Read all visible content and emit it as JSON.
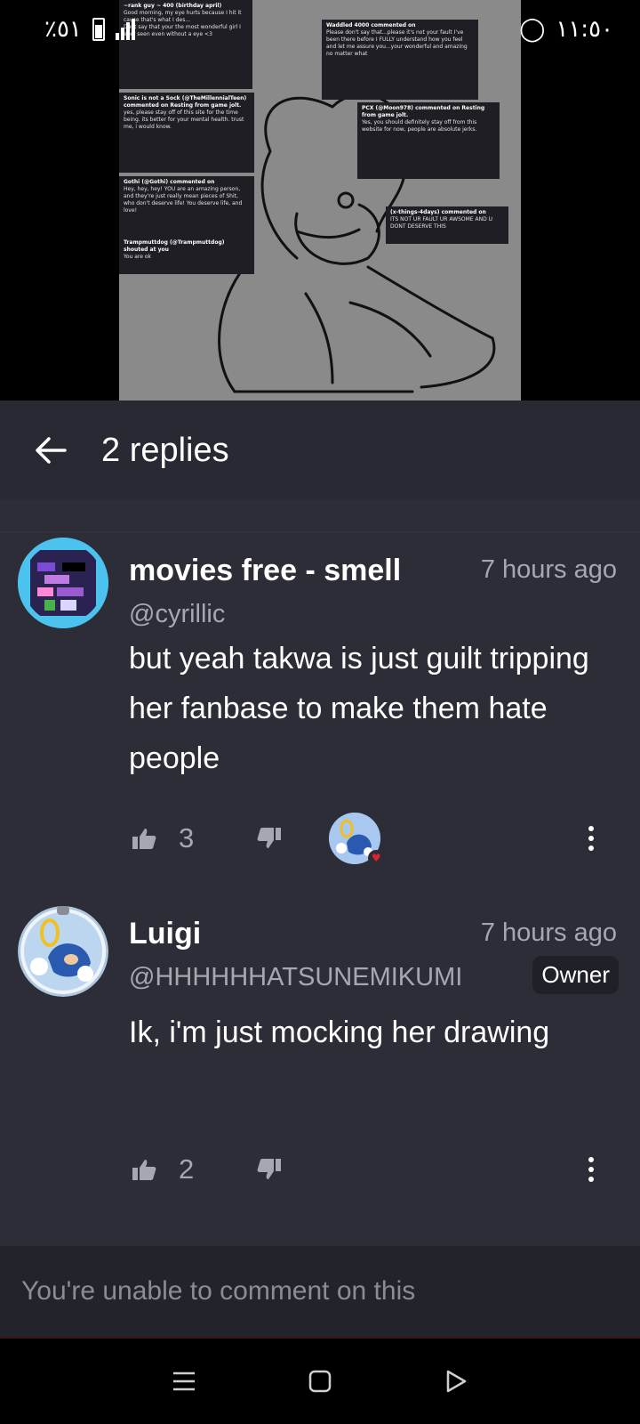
{
  "status_bar": {
    "battery_text": "٪٥١",
    "time": "١١:٥٠"
  },
  "media_notes": [
    {
      "user": "Sonic is not a Sock (@TheMillennialTeen) commented on Resting from game jolt.",
      "text": "yes, please stay off of this site for the time being. its better for your mental health. trust me, i would know."
    },
    {
      "user": "Trampmuttdog (@Trampmuttdog) shouted at you",
      "text": "You are ok"
    },
    {
      "user": "PCX (@Moon978) commented on Resting from game jolt.",
      "text": "Yes, you should definitely stay off from this website for now, people are absolute jerks."
    }
  ],
  "header": {
    "title": "2 replies"
  },
  "comments": [
    {
      "username": "movies free - smell",
      "timestamp": "7 hours ago",
      "handle": "@cyrillic",
      "body": "but yeah takwa is just guilt tripping her fanbase to make them hate people",
      "likes": "3",
      "badge": ""
    },
    {
      "username": "Luigi",
      "timestamp": "7 hours ago",
      "handle": "@HHHHHHATSUNEMIKUMI",
      "body": "Ik, i'm just mocking her drawing",
      "likes": "2",
      "badge": "Owner"
    }
  ],
  "footer": {
    "disabled_text": "You're unable to comment on this"
  },
  "colors": {
    "background": "#2c2d36",
    "header": "#282a33",
    "muted_text": "#a6a7b0"
  }
}
